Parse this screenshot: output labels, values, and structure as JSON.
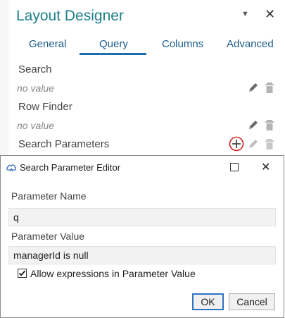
{
  "panel": {
    "title": "Layout Designer",
    "tabs": [
      {
        "label": "General"
      },
      {
        "label": "Query",
        "active": true
      },
      {
        "label": "Columns"
      },
      {
        "label": "Advanced"
      }
    ],
    "properties": [
      {
        "label": "Search",
        "value": "no value"
      },
      {
        "label": "Row Finder",
        "value": "no value"
      },
      {
        "label": "Search Parameters"
      }
    ],
    "colors": {
      "title": "#1e7f8a",
      "tab_text": "#1b5a8a",
      "tab_underline": "#1b6db0",
      "add_circle": "#d32020"
    }
  },
  "dialog": {
    "title": "Search Parameter Editor",
    "fields": {
      "name_label": "Parameter Name",
      "name_value": "q",
      "value_label": "Parameter Value",
      "value_value": "managerId is null"
    },
    "checkbox": {
      "label": "Allow expressions in Parameter Value",
      "checked": true
    },
    "buttons": {
      "ok": "OK",
      "cancel": "Cancel"
    }
  },
  "icons": [
    "chevron-down-icon",
    "close-icon",
    "pencil-icon",
    "trash-icon",
    "add-circle-icon",
    "cloud-icon",
    "maximize-icon",
    "checkmark-icon"
  ]
}
